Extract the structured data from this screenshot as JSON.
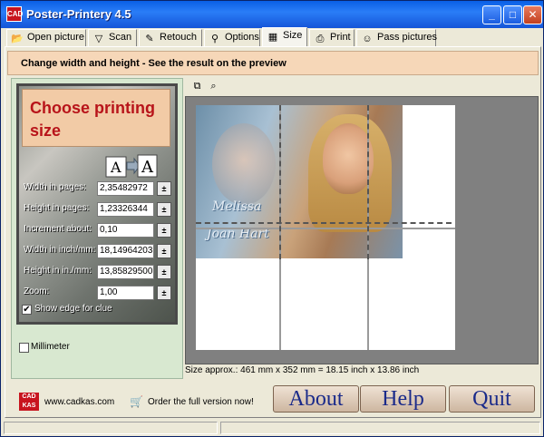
{
  "window": {
    "title": "Poster-Printery 4.5"
  },
  "tabs": [
    {
      "label": "Open picture",
      "icon": "folder-open-icon"
    },
    {
      "label": "Scan",
      "icon": "funnel-icon"
    },
    {
      "label": "Retouch",
      "icon": "retouch-icon"
    },
    {
      "label": "Options",
      "icon": "binoculars-icon"
    },
    {
      "label": "Size",
      "icon": "grid-icon",
      "active": true
    },
    {
      "label": "Print",
      "icon": "printer-icon"
    },
    {
      "label": "Pass pictures",
      "icon": "person-icon"
    }
  ],
  "banner": {
    "text": "Change width and height - See the result on the preview"
  },
  "left_panel": {
    "heading": "Choose printing size",
    "fields": [
      {
        "label": "Width in pages:",
        "value": "2,35482972"
      },
      {
        "label": "Height in pages:",
        "value": "1,23326344"
      },
      {
        "label": "Increment about:",
        "value": "0,10"
      },
      {
        "label": "Width in inch/mm:",
        "value": "18,14964203"
      },
      {
        "label": "Height in in./mm:",
        "value": "13,85829500"
      },
      {
        "label": "Zoom:",
        "value": "1,00"
      }
    ],
    "show_edge_label": "Show edge for clue",
    "show_edge_checked": true,
    "millimeter_label": "Millimeter",
    "millimeter_checked": false
  },
  "preview": {
    "signature_line1": "Melissa",
    "signature_line2": "Joan Hart",
    "status": "Size approx.: 461 mm x 352 mm = 18.15 inch x 13.86 inch"
  },
  "bottom": {
    "website": "www.cadkas.com",
    "order_text": "Order the full version now!",
    "about_label": "About",
    "help_label": "Help",
    "quit_label": "Quit"
  },
  "colors": {
    "accent_red": "#b8141a",
    "banner_bg": "#f6d7b8",
    "button_text": "#1a2a8a"
  }
}
